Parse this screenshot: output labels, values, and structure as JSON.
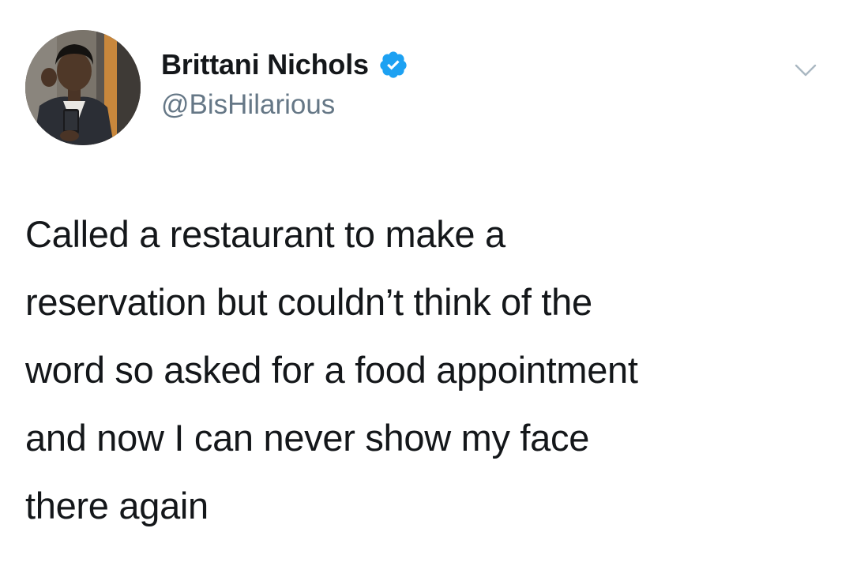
{
  "tweet": {
    "author": {
      "display_name": "Brittani Nichols",
      "handle": "@BisHilarious",
      "verified": true,
      "avatar_icon": "profile-photo",
      "verified_icon": "verified-badge-icon"
    },
    "menu_icon": "chevron-down-icon",
    "text_lines": [
      "Called a restaurant to make a",
      "reservation but couldn’t think of the",
      "word so asked for a food appointment",
      "and now I can never show my face",
      "there again"
    ]
  },
  "colors": {
    "background": "#ffffff",
    "text": "#14171a",
    "secondary_text": "#657786",
    "verified_blue": "#1da1f2",
    "caret": "#aab8c2"
  }
}
